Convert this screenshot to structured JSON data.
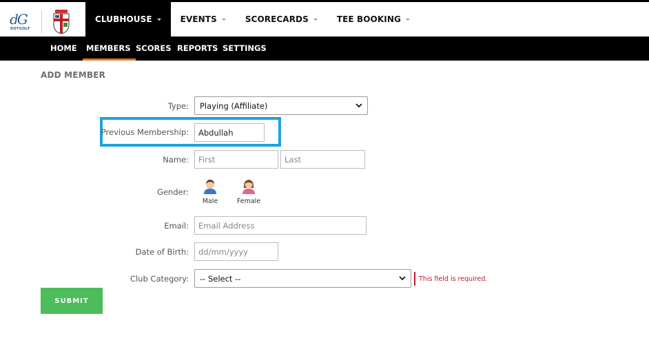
{
  "brand": {
    "logo_text": "dG",
    "logo_sub": "DOTGOLF"
  },
  "topnav": [
    {
      "label": "CLUBHOUSE"
    },
    {
      "label": "EVENTS"
    },
    {
      "label": "SCORECARDS"
    },
    {
      "label": "TEE BOOKING"
    }
  ],
  "subnav": [
    {
      "label": "HOME"
    },
    {
      "label": "MEMBERS"
    },
    {
      "label": "SCORES"
    },
    {
      "label": "REPORTS"
    },
    {
      "label": "SETTINGS"
    }
  ],
  "page": {
    "title": "ADD MEMBER"
  },
  "form": {
    "type_label": "Type:",
    "type_value": "Playing (Affiliate)",
    "previous_membership_label": "Previous Membership:",
    "previous_membership_value": "Abdullah",
    "name_label": "Name:",
    "first_placeholder": "First",
    "last_placeholder": "Last",
    "gender_label": "Gender:",
    "gender_male": "Male",
    "gender_female": "Female",
    "email_label": "Email:",
    "email_placeholder": "Email Address",
    "dob_label": "Date of Birth:",
    "dob_placeholder": "dd/mm/yyyy",
    "club_category_label": "Club Category:",
    "club_category_value": "-- Select --",
    "club_category_error": "This field is required.",
    "submit_label": "SUBMIT"
  },
  "colors": {
    "active_tab_underline": "#e07b1f",
    "highlight_border": "#1ea1dc",
    "error": "#c0142b",
    "submit_bg": "#4cbd5a"
  }
}
